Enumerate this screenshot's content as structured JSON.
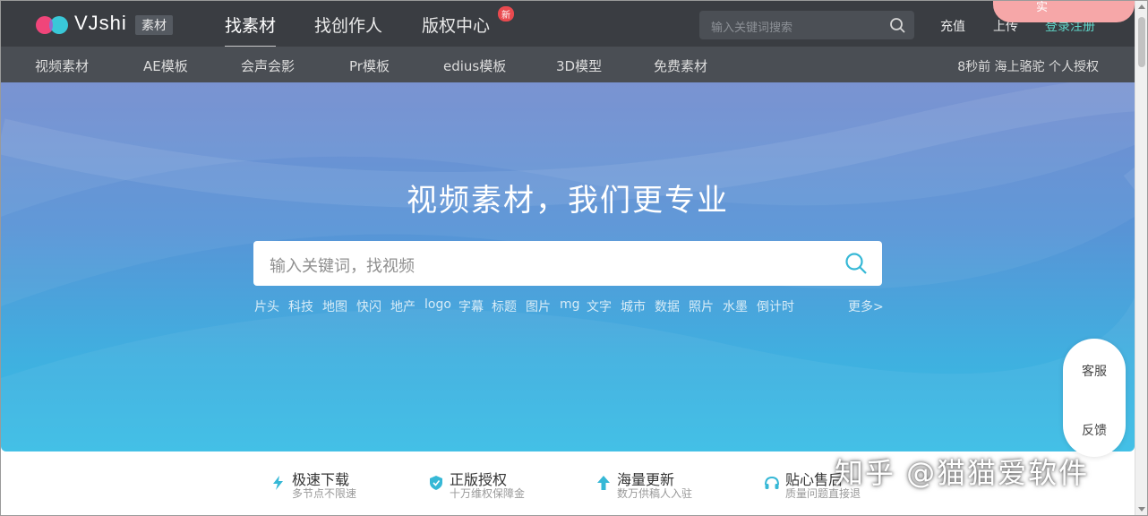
{
  "header": {
    "brand": "VJshi",
    "brand_tag": "素材",
    "nav": [
      "找素材",
      "找创作人",
      "版权中心"
    ],
    "new_badge": "新",
    "search_placeholder": "输入关键词搜索",
    "recharge": "充值",
    "upload": "上传",
    "login": "登录注册",
    "promo_text": "实"
  },
  "subnav": {
    "items": [
      "视频素材",
      "AE模板",
      "会声会影",
      "Pr模板",
      "edius模板",
      "3D模型",
      "免费素材"
    ],
    "activity": "8秒前 海上骆驼 个人授权"
  },
  "hero": {
    "title": "视频素材，我们更专业",
    "search_placeholder": "输入关键词，找视频",
    "tags": [
      "片头",
      "科技",
      "地图",
      "快闪",
      "地产",
      "logo",
      "字幕",
      "标题",
      "图片",
      "mg",
      "文字",
      "城市",
      "数据",
      "照片",
      "水墨",
      "倒计时"
    ],
    "more": "更多>"
  },
  "side_widget": {
    "service": "客服",
    "feedback": "反馈"
  },
  "features": [
    {
      "title": "极速下载",
      "sub": "多节点不限速",
      "icon": "lightning-icon"
    },
    {
      "title": "正版授权",
      "sub": "十万维权保障金",
      "icon": "shield-icon"
    },
    {
      "title": "海量更新",
      "sub": "数万供稿人入驻",
      "icon": "arrow-up-icon"
    },
    {
      "title": "贴心售后",
      "sub": "质量问题直接退",
      "icon": "headphones-icon"
    }
  ],
  "watermark": "知乎 @猫猫爱软件",
  "colors": {
    "accent": "#36b8d6",
    "nav_bg": "#3a3d42",
    "subnav_bg": "#4a4e54",
    "login": "#5fd3c6",
    "badge": "#e94a4f"
  }
}
